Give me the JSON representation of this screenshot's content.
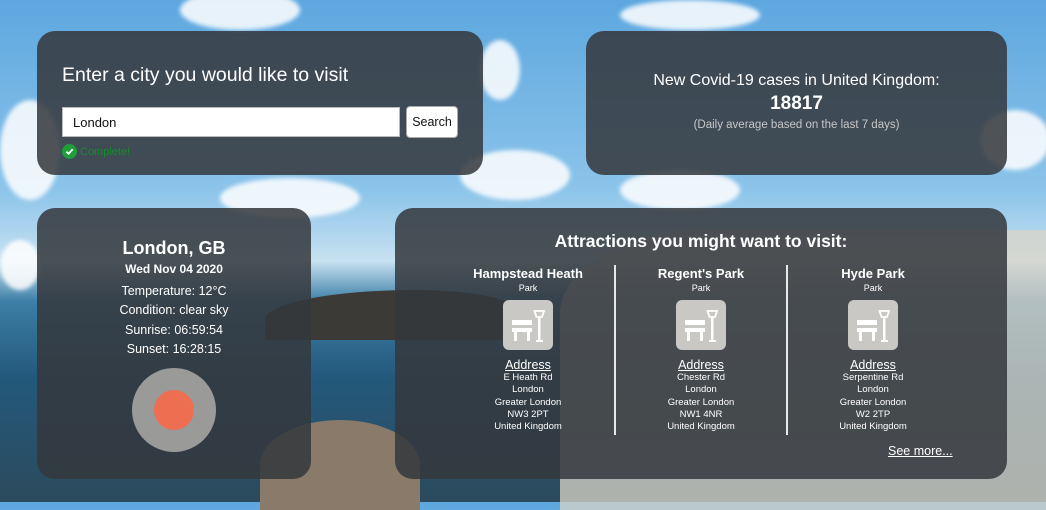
{
  "search": {
    "title": "Enter a city you would like to visit",
    "input_value": "London",
    "button_label": "Search",
    "status": "Complete!"
  },
  "covid": {
    "heading": "New Covid-19 cases in United Kingdom:",
    "count": "18817",
    "note": "(Daily average based on the last 7 days)"
  },
  "weather": {
    "city": "London, GB",
    "date": "Wed Nov 04 2020",
    "temperature": "Temperature: 12°C",
    "condition": "Condition: clear sky",
    "sunrise": "Sunrise: 06:59:54",
    "sunset": "Sunset: 16:28:15",
    "icon": "clear-sky-sun-icon"
  },
  "attractions": {
    "title": "Attractions you might want to visit:",
    "address_label": "Address",
    "see_more": "See more...",
    "items": [
      {
        "name": "Hampstead Heath",
        "type": "Park",
        "icon": "park-bench-icon",
        "address": [
          "E Heath Rd",
          "London",
          "Greater London",
          "NW3 2PT",
          "United Kingdom"
        ]
      },
      {
        "name": "Regent's Park",
        "type": "Park",
        "icon": "park-bench-icon",
        "address": [
          "Chester Rd",
          "London",
          "Greater London",
          "NW1 4NR",
          "United Kingdom"
        ]
      },
      {
        "name": "Hyde Park",
        "type": "Park",
        "icon": "park-bench-icon",
        "address": [
          "Serpentine Rd",
          "London",
          "Greater London",
          "W2 2TP",
          "United Kingdom"
        ]
      }
    ]
  }
}
